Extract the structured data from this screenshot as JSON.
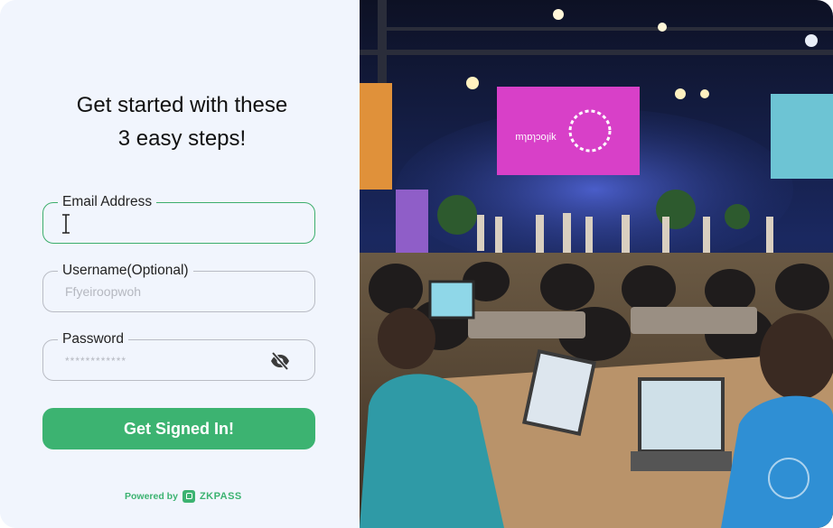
{
  "heading": {
    "line1": "Get started with these",
    "line2": "3 easy steps!"
  },
  "form": {
    "email": {
      "label": "Email Address",
      "value": ""
    },
    "username": {
      "label": "Username(Optional)",
      "placeholder": "Ffyeiroopwoh"
    },
    "password": {
      "label": "Password",
      "value": "************"
    },
    "submit_label": "Get Signed In!"
  },
  "footer": {
    "powered_by": "Powered by",
    "brand": "ZKPASS"
  },
  "colors": {
    "accent": "#3cb371",
    "panel": "#f1f5fd"
  },
  "image": {
    "description_icon": "conference-photo",
    "screen_text": "mɿɒɿɔoꞁik"
  }
}
